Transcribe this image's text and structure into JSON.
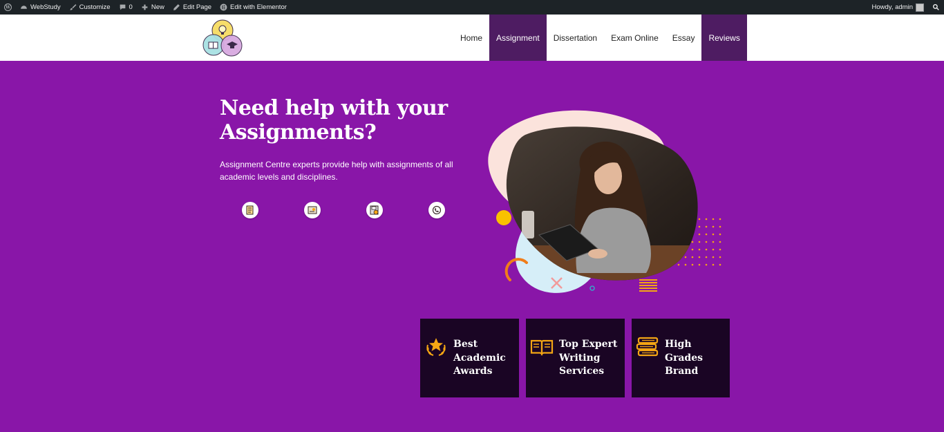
{
  "adminbar": {
    "site_name": "WebStudy",
    "customize": "Customize",
    "comments_count": "0",
    "new": "New",
    "edit_page": "Edit Page",
    "edit_elementor": "Edit with Elementor",
    "howdy": "Howdy, admin"
  },
  "nav": {
    "items": [
      "Home",
      "Assignment",
      "Dissertation",
      "Exam Online",
      "Essay",
      "Reviews"
    ],
    "active": [
      "Assignment",
      "Reviews"
    ]
  },
  "hero": {
    "title": "Need help with your Assignments?",
    "text": "Assignment Centre experts provide help with assignments of all academic levels and disciplines.",
    "feature_icons": [
      "checklist-icon",
      "certificate-icon",
      "floppy-check-icon",
      "phone-support-icon"
    ]
  },
  "cards": [
    {
      "title": "Best Academic Awards",
      "icon": "laurel-star-icon"
    },
    {
      "title": "Top Expert Writing Services",
      "icon": "open-book-icon"
    },
    {
      "title": "High Grades Brand",
      "icon": "book-stack-icon"
    }
  ],
  "colors": {
    "hero_bg": "#8916a8",
    "nav_active": "#4e1c62",
    "card_bg": "#1a0524",
    "accent_orange": "#f4a614",
    "adminbar": "#1d2327"
  }
}
